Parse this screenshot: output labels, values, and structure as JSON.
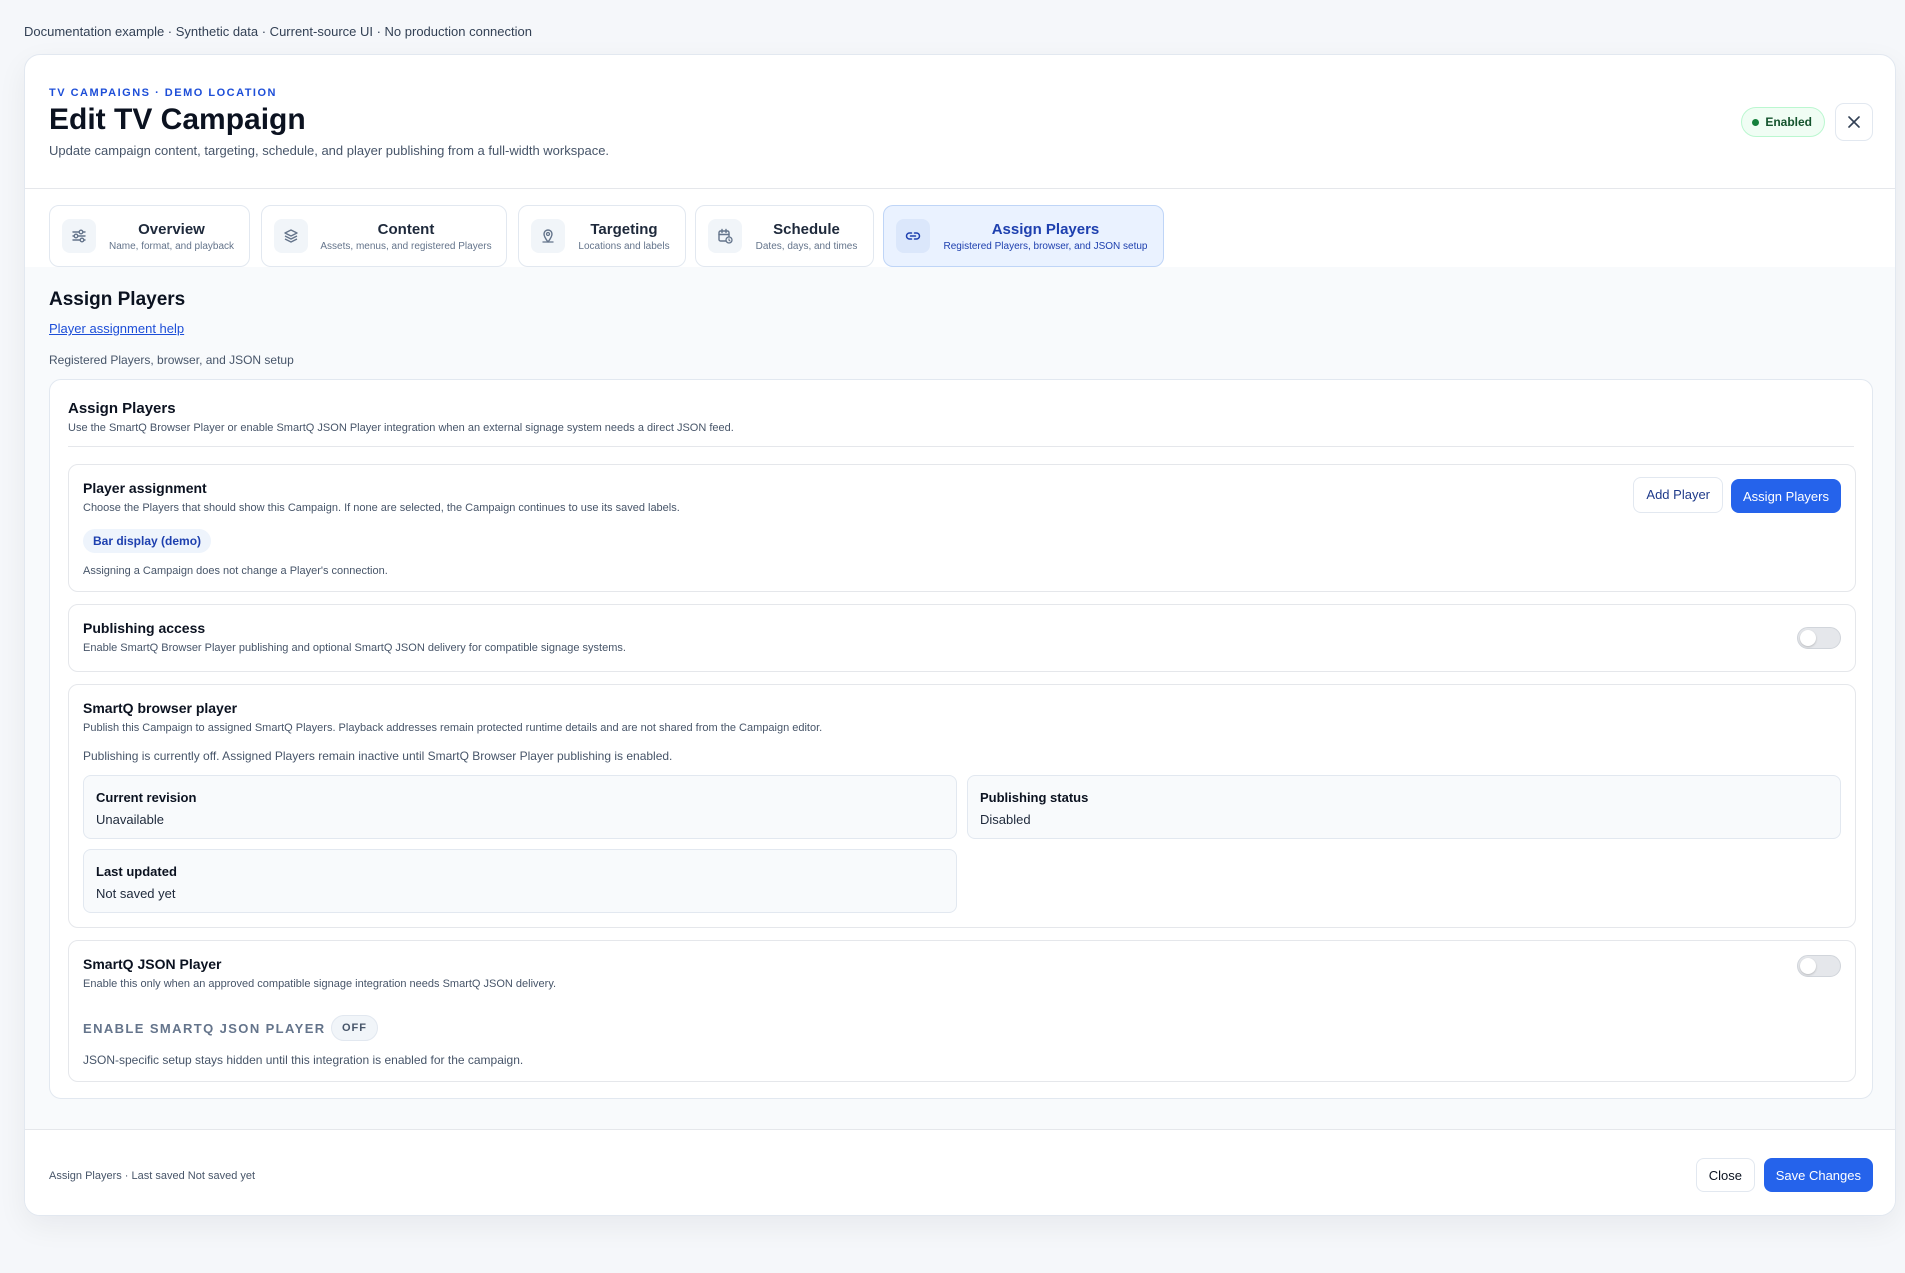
{
  "top_note": "Documentation example · Synthetic data · Current-source UI · No production connection",
  "header": {
    "eyebrow": "TV CAMPAIGNS · DEMO LOCATION",
    "title": "Edit TV Campaign",
    "subtitle": "Update campaign content, targeting, schedule, and player publishing from a full-width workspace.",
    "status_badge": "Enabled"
  },
  "tabs": [
    {
      "label": "Overview",
      "desc": "Name, format, and playback",
      "icon": "sliders-icon"
    },
    {
      "label": "Content",
      "desc": "Assets, menus, and registered Players",
      "icon": "layers-icon"
    },
    {
      "label": "Targeting",
      "desc": "Locations and labels",
      "icon": "location-pin-icon"
    },
    {
      "label": "Schedule",
      "desc": "Dates, days, and times",
      "icon": "calendar-clock-icon"
    },
    {
      "label": "Assign Players",
      "desc": "Registered Players, browser, and JSON setup",
      "icon": "link-icon",
      "active": true
    }
  ],
  "section": {
    "title": "Assign Players",
    "help_link": "Player assignment help",
    "desc": "Registered Players, browser, and JSON setup"
  },
  "card": {
    "title": "Assign Players",
    "desc": "Use the SmartQ Browser Player or enable SmartQ JSON Player integration when an external signage system needs a direct JSON feed."
  },
  "assignment": {
    "title": "Player assignment",
    "desc": "Choose the Players that should show this Campaign. If none are selected, the Campaign continues to use its saved labels.",
    "chip": "Bar display (demo)",
    "note": "Assigning a Campaign does not change a Player's connection.",
    "add_button": "Add Player",
    "assign_button": "Assign Players"
  },
  "publishing": {
    "title": "Publishing access",
    "desc": "Enable SmartQ Browser Player publishing and optional SmartQ JSON delivery for compatible signage systems.",
    "enabled": false
  },
  "browser_player": {
    "title": "SmartQ browser player",
    "desc": "Publish this Campaign to assigned SmartQ Players. Playback addresses remain protected runtime details and are not shared from the Campaign editor.",
    "notice": "Publishing is currently off. Assigned Players remain inactive until SmartQ Browser Player publishing is enabled.",
    "stats": [
      {
        "label": "Current revision",
        "value": "Unavailable"
      },
      {
        "label": "Publishing status",
        "value": "Disabled"
      },
      {
        "label": "Last updated",
        "value": "Not saved yet"
      }
    ]
  },
  "json_player": {
    "title": "SmartQ JSON Player",
    "desc": "Enable this only when an approved compatible signage integration needs SmartQ JSON delivery.",
    "enable_label": "ENABLE SMARTQ JSON PLAYER",
    "state_pill": "OFF",
    "note": "JSON-specific setup stays hidden until this integration is enabled for the campaign.",
    "enabled": false
  },
  "footer": {
    "status": "Assign Players · Last saved Not saved yet",
    "close_button": "Close",
    "save_button": "Save Changes"
  },
  "colors": {
    "primary": "#2563eb",
    "accent_text": "#1d4ed8",
    "success": "#15803d",
    "active_tab_bg": "#eaf2ff"
  }
}
